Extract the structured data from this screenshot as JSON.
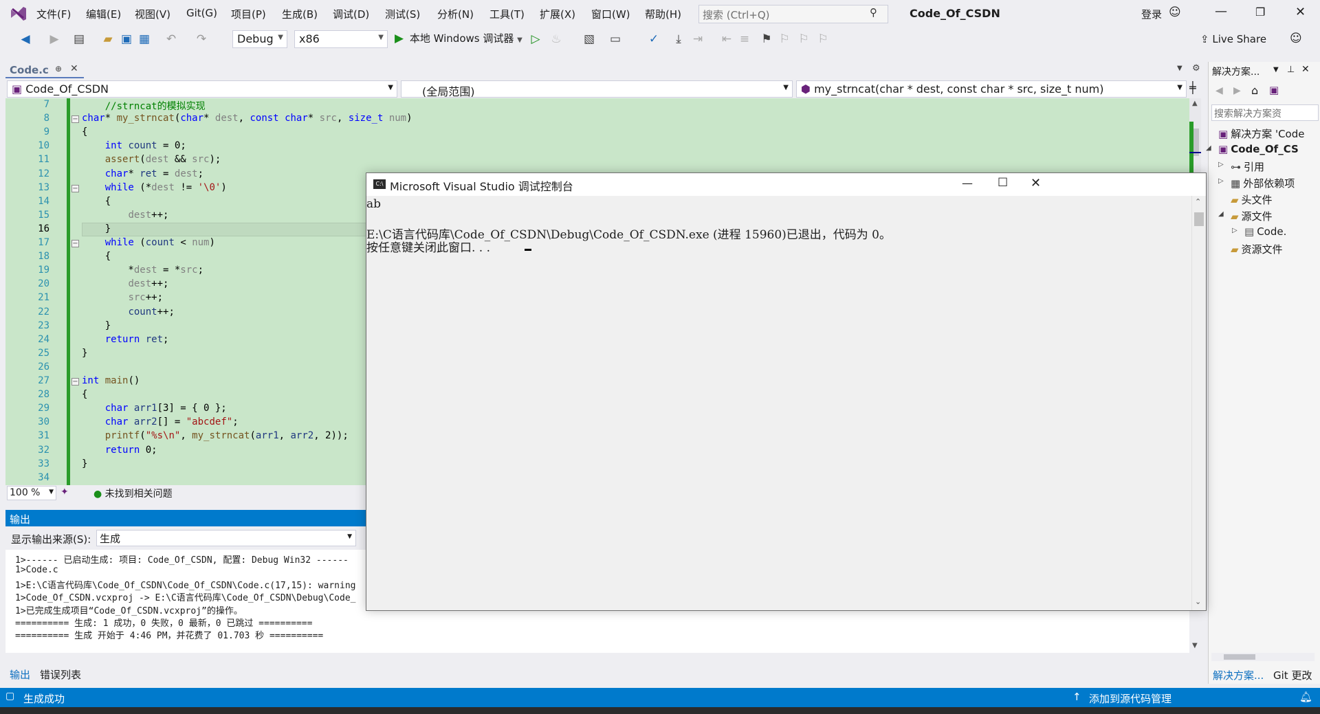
{
  "menu": [
    "文件(F)",
    "编辑(E)",
    "视图(V)",
    "Git(G)",
    "项目(P)",
    "生成(B)",
    "调试(D)",
    "测试(S)",
    "分析(N)",
    "工具(T)",
    "扩展(X)",
    "窗口(W)",
    "帮助(H)"
  ],
  "search": {
    "placeholder": "搜索 (Ctrl+Q)"
  },
  "title": {
    "project": "Code_Of_CSDN",
    "login": "登录"
  },
  "toolbar": {
    "config": "Debug",
    "platform": "x86",
    "run_label": "本地 Windows 调试器",
    "live_share": "Live Share"
  },
  "doc_tab": {
    "name": "Code.c"
  },
  "nav": {
    "project": "Code_Of_CSDN",
    "scope": "(全局范围)",
    "member": "my_strncat(char * dest, const char * src, size_t num)"
  },
  "editor": {
    "current_line": "16",
    "lines": [
      {
        "n": "7",
        "text": "    //strncat的模拟实现"
      },
      {
        "n": "8",
        "text": "char* my_strncat(char* dest, const char* src, size_t num)"
      },
      {
        "n": "9",
        "text": "{"
      },
      {
        "n": "10",
        "text": "    int count = 0;"
      },
      {
        "n": "11",
        "text": "    assert(dest && src);"
      },
      {
        "n": "12",
        "text": "    char* ret = dest;"
      },
      {
        "n": "13",
        "text": "    while (*dest != '\\0')"
      },
      {
        "n": "14",
        "text": "    {"
      },
      {
        "n": "15",
        "text": "        dest++;"
      },
      {
        "n": "16",
        "text": "    }"
      },
      {
        "n": "17",
        "text": "    while (count < num)"
      },
      {
        "n": "18",
        "text": "    {"
      },
      {
        "n": "19",
        "text": "        *dest = *src;"
      },
      {
        "n": "20",
        "text": "        dest++;"
      },
      {
        "n": "21",
        "text": "        src++;"
      },
      {
        "n": "22",
        "text": "        count++;"
      },
      {
        "n": "23",
        "text": "    }"
      },
      {
        "n": "24",
        "text": "    return ret;"
      },
      {
        "n": "25",
        "text": "}"
      },
      {
        "n": "26",
        "text": ""
      },
      {
        "n": "27",
        "text": "int main()"
      },
      {
        "n": "28",
        "text": "{"
      },
      {
        "n": "29",
        "text": "    char arr1[3] = { 0 };"
      },
      {
        "n": "30",
        "text": "    char arr2[] = \"abcdef\";"
      },
      {
        "n": "31",
        "text": "    printf(\"%s\\n\", my_strncat(arr1, arr2, 2));"
      },
      {
        "n": "32",
        "text": "    return 0;"
      },
      {
        "n": "33",
        "text": "}"
      },
      {
        "n": "34",
        "text": ""
      }
    ]
  },
  "editor_status": {
    "zoom": "100 %",
    "issues": "未找到相关问题"
  },
  "output": {
    "title": "输出",
    "source_label": "显示输出来源(S):",
    "source_value": "生成",
    "lines": [
      "1>------ 已启动生成: 项目: Code_Of_CSDN, 配置: Debug Win32 ------",
      "1>Code.c",
      "1>E:\\C语言代码库\\Code_Of_CSDN\\Code_Of_CSDN\\Code.c(17,15): warning",
      "1>Code_Of_CSDN.vcxproj -> E:\\C语言代码库\\Code_Of_CSDN\\Debug\\Code_",
      "1>已完成生成项目“Code_Of_CSDN.vcxproj”的操作。",
      "========== 生成: 1 成功，0 失败，0 最新，0 已跳过 ==========",
      "========== 生成 开始于 4:46 PM，并花费了 01.703 秒 =========="
    ]
  },
  "bottom_tabs": [
    "输出",
    "错误列表"
  ],
  "statusbar": {
    "left": "生成成功",
    "right": "添加到源代码管理"
  },
  "solution": {
    "title": "解决方案...",
    "search_placeholder": "搜索解决方案资",
    "items": [
      "解决方案 'Code",
      "Code_Of_CS",
      "引用",
      "外部依赖项",
      "头文件",
      "源文件",
      "Code.",
      "资源文件"
    ],
    "tabs": [
      "解决方案...",
      "Git 更改"
    ]
  },
  "console": {
    "title": "Microsoft Visual Studio 调试控制台",
    "lines": [
      "ab",
      "",
      "E:\\C语言代码库\\Code_Of_CSDN\\Debug\\Code_Of_CSDN.exe (进程 15960)已退出，代码为 0。",
      "按任意键关闭此窗口. . ."
    ]
  },
  "colors": {
    "accent": "#007acc",
    "editor_bg": "#c9e6c9",
    "keyword": "#0000ff",
    "string": "#a31515",
    "comment": "#008000"
  }
}
